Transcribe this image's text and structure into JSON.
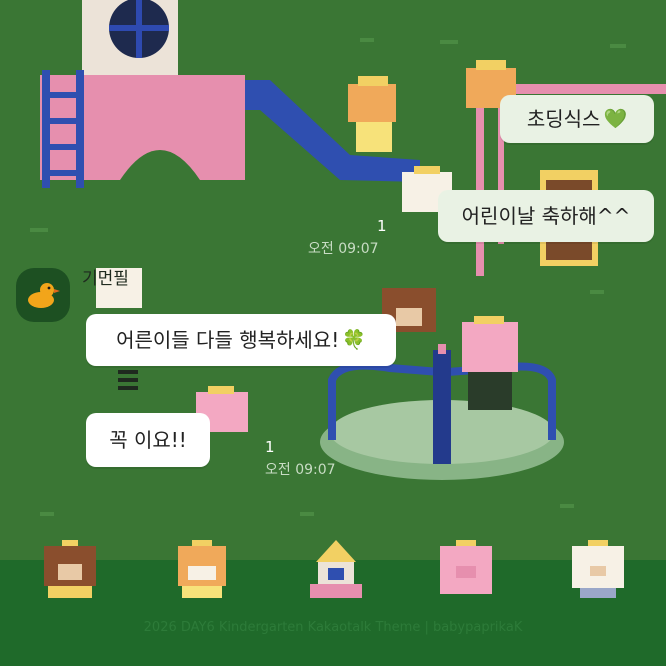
{
  "chat": {
    "messages": [
      {
        "id": "m1",
        "side": "mine",
        "text": "초딩식스",
        "emoji": "💚"
      },
      {
        "id": "m2",
        "side": "mine",
        "text": "어린이날 축하해^^",
        "unread": "1",
        "time": "오전 09:07"
      },
      {
        "id": "m3",
        "side": "theirs",
        "sender": "기먼필",
        "text": "어른이들 다들 행복하세요!",
        "emoji": "🍀"
      },
      {
        "id": "m4",
        "side": "theirs",
        "text": "꼭 이요!!",
        "unread": "1",
        "time": "오전 09:07"
      }
    ]
  },
  "footer": {
    "tabs": [
      {
        "name": "tab-bear-character",
        "icon": "bear-icon"
      },
      {
        "name": "tab-tiger-character",
        "icon": "tiger-icon"
      },
      {
        "name": "tab-house",
        "icon": "house-icon"
      },
      {
        "name": "tab-pig-character",
        "icon": "pig-icon"
      },
      {
        "name": "tab-white-bear-character",
        "icon": "white-bear-icon"
      }
    ],
    "credit": "2026 DAY6 Kindergarten Kakaotalk Theme | babypaprikaK"
  },
  "colors": {
    "background": "#356f31",
    "footer": "#1f6a2a",
    "bubble_mine": "#e9f2e4",
    "bubble_theirs": "#ffffff",
    "slide_blue": "#2f4fb0",
    "pink": "#e68fae"
  }
}
